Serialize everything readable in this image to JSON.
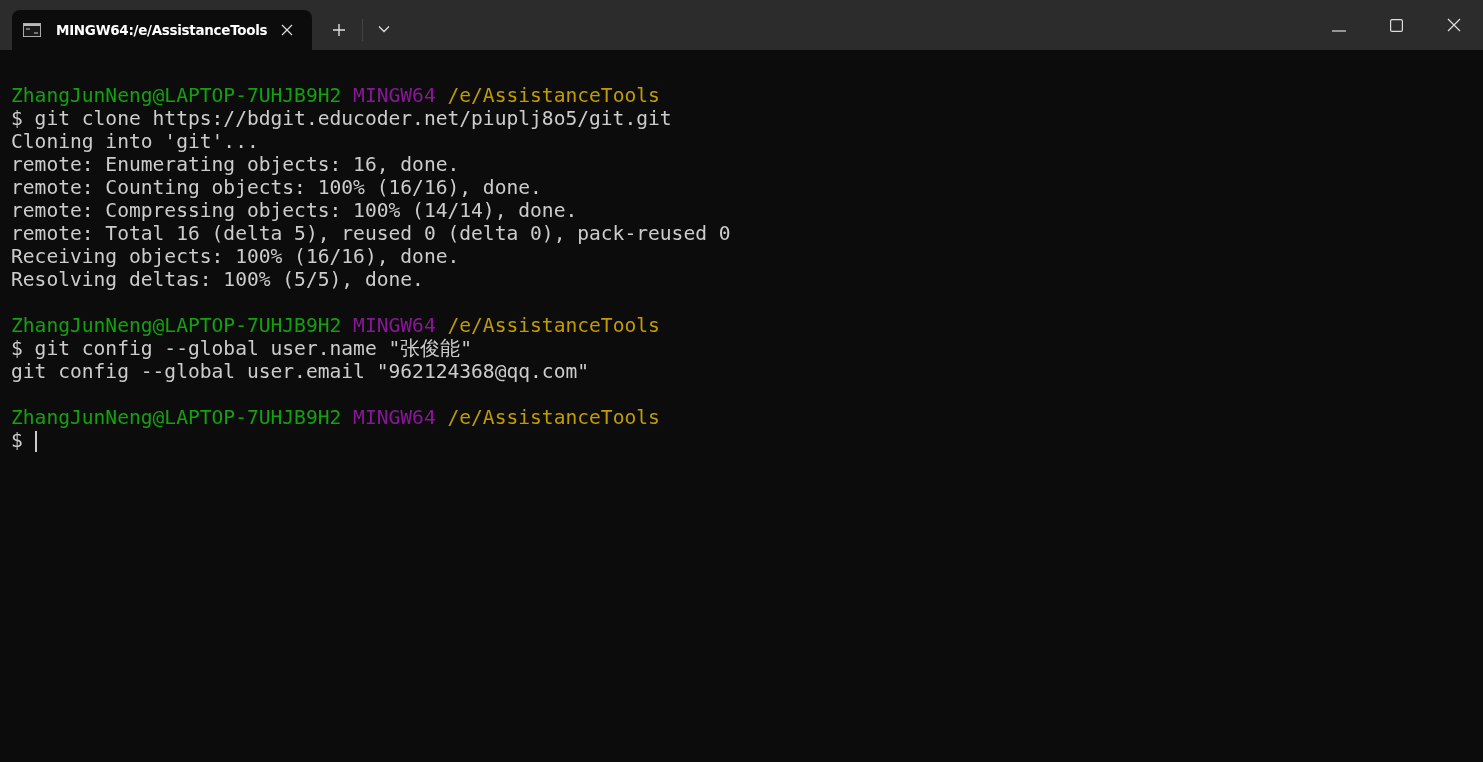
{
  "window": {
    "tab": {
      "title": "MINGW64:/e/AssistanceTools",
      "selected": true
    }
  },
  "terminal": {
    "blocks": [
      [
        {
          "kind": "prompt",
          "user": "ZhangJunNeng@LAPTOP-7UHJB9H2",
          "system": "MINGW64",
          "path": "/e/AssistanceTools"
        },
        {
          "kind": "command",
          "symbol": "$",
          "text": "git clone https://bdgit.educoder.net/piuplj8o5/git.git"
        },
        {
          "kind": "output",
          "text": "Cloning into 'git'..."
        },
        {
          "kind": "output",
          "text": "remote: Enumerating objects: 16, done."
        },
        {
          "kind": "output",
          "text": "remote: Counting objects: 100% (16/16), done."
        },
        {
          "kind": "output",
          "text": "remote: Compressing objects: 100% (14/14), done."
        },
        {
          "kind": "output",
          "text": "remote: Total 16 (delta 5), reused 0 (delta 0), pack-reused 0"
        },
        {
          "kind": "output",
          "text": "Receiving objects: 100% (16/16), done."
        },
        {
          "kind": "output",
          "text": "Resolving deltas: 100% (5/5), done."
        }
      ],
      [
        {
          "kind": "prompt",
          "user": "ZhangJunNeng@LAPTOP-7UHJB9H2",
          "system": "MINGW64",
          "path": "/e/AssistanceTools"
        },
        {
          "kind": "command",
          "symbol": "$",
          "text": "git config --global user.name \"张俊能\""
        },
        {
          "kind": "output",
          "text": "git config --global user.email \"962124368@qq.com\""
        }
      ],
      [
        {
          "kind": "prompt",
          "user": "ZhangJunNeng@LAPTOP-7UHJB9H2",
          "system": "MINGW64",
          "path": "/e/AssistanceTools"
        },
        {
          "kind": "input",
          "symbol": "$",
          "cursor": true
        }
      ]
    ]
  }
}
